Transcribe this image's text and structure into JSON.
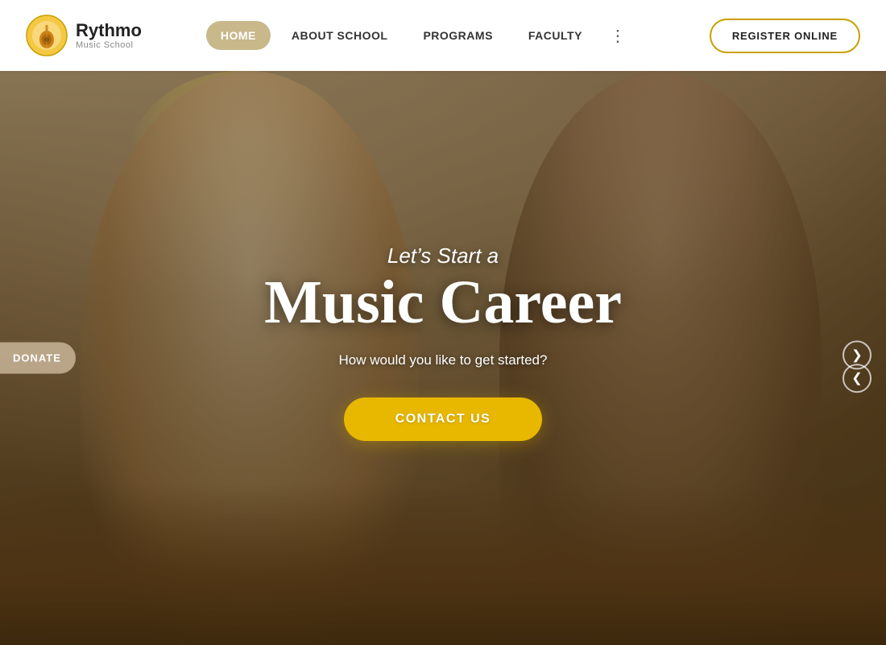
{
  "logo": {
    "name": "Rythmo",
    "subtitle": "Music School"
  },
  "nav": {
    "items": [
      {
        "label": "HOME",
        "active": true
      },
      {
        "label": "ABOUT SCHOOL",
        "active": false
      },
      {
        "label": "PROGRAMS",
        "active": false
      },
      {
        "label": "FACULTY",
        "active": false
      }
    ],
    "register_label": "REGISTER ONLINE",
    "more_icon": "⋮"
  },
  "hero": {
    "subtitle": "Let’s Start a",
    "title": "Music Career",
    "question": "How would you like to get started?",
    "contact_label": "CONTACT US",
    "donate_label": "DONATE"
  },
  "carousel": {
    "next_icon": "❯",
    "prev_icon": "❮"
  }
}
